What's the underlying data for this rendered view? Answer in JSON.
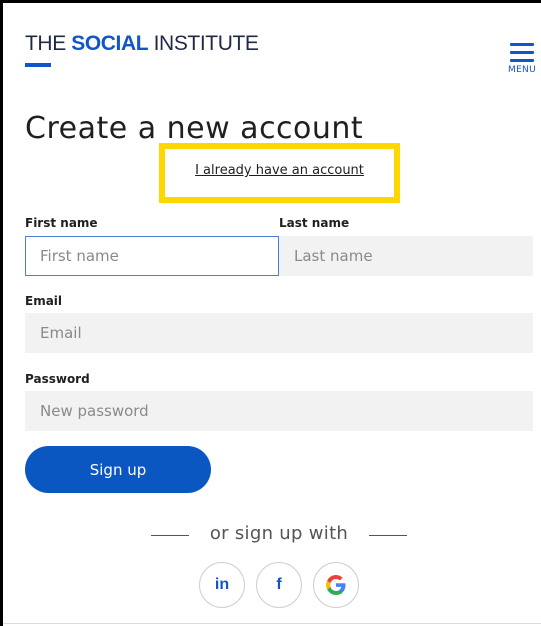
{
  "header": {
    "logo_prefix": "THE ",
    "logo_bold": "SOCIAL",
    "logo_suffix": " INSTITUTE",
    "menu_label": "MENU"
  },
  "page": {
    "title": "Create a new account",
    "login_link": "I already have an account"
  },
  "form": {
    "first_name": {
      "label": "First name",
      "placeholder": "First name",
      "value": ""
    },
    "last_name": {
      "label": "Last name",
      "placeholder": "Last name",
      "value": ""
    },
    "email": {
      "label": "Email",
      "placeholder": "Email",
      "value": ""
    },
    "password": {
      "label": "Password",
      "placeholder": "New password",
      "value": ""
    },
    "submit_label": "Sign up"
  },
  "social": {
    "divider_text": "or sign up with",
    "linkedin_glyph": "in",
    "facebook_glyph": "f",
    "google_glyph": "G"
  },
  "colors": {
    "brand_blue": "#1255c8",
    "button_blue": "#0b57c2",
    "highlight_yellow": "#ffd600",
    "field_bg": "#f2f2f2",
    "google_colors": [
      "#4285F4",
      "#EA4335",
      "#FBBC05",
      "#34A853"
    ]
  },
  "icons": {
    "menu": "hamburger-icon",
    "linkedin": "linkedin-icon",
    "facebook": "facebook-icon",
    "google": "google-icon"
  }
}
